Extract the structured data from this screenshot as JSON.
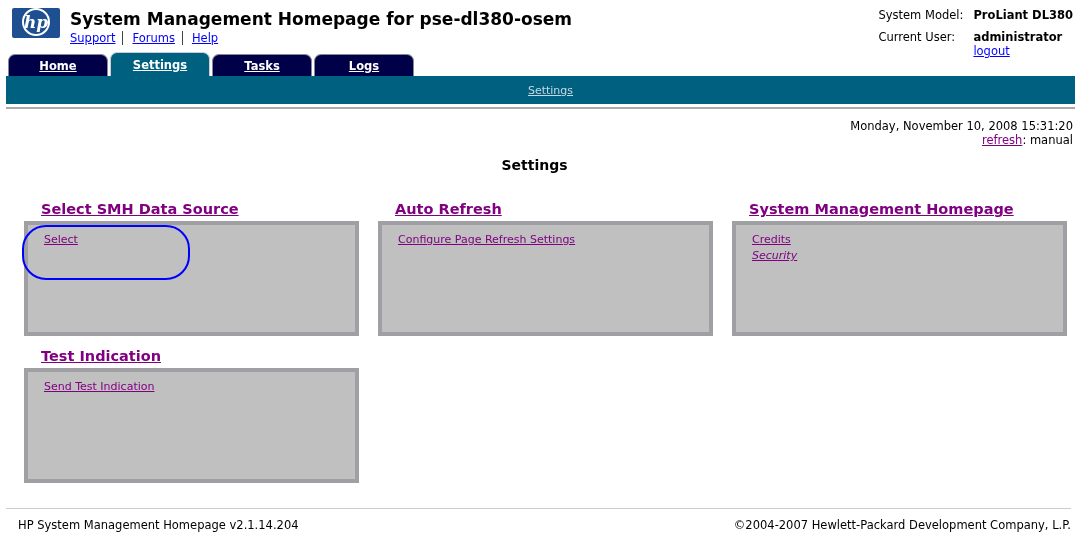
{
  "header": {
    "logo_text": "hp",
    "title": "System Management Homepage for pse-dl380-osem",
    "links": [
      "Support",
      "Forums",
      "Help"
    ],
    "info": [
      {
        "label": "System Model:",
        "value": "ProLiant DL380"
      },
      {
        "label": "Current User:",
        "value": "administrator"
      }
    ],
    "logout": "logout"
  },
  "tabs": [
    {
      "label": "Home",
      "selected": false
    },
    {
      "label": "Settings",
      "selected": true
    },
    {
      "label": "Tasks",
      "selected": false
    },
    {
      "label": "Logs",
      "selected": false
    }
  ],
  "subnav": [
    "Settings"
  ],
  "timestamp": "Monday, November 10, 2008 15:31:20",
  "refresh": {
    "link": "refresh",
    "value": ": manual"
  },
  "page_title": "Settings",
  "panels": [
    {
      "title": "Select SMH Data Source",
      "highlighted": true,
      "links": [
        {
          "text": "Select",
          "italic": false
        }
      ]
    },
    {
      "title": "Auto Refresh",
      "highlighted": false,
      "links": [
        {
          "text": "Configure Page Refresh Settings",
          "italic": false
        }
      ]
    },
    {
      "title": "System Management Homepage",
      "highlighted": false,
      "links": [
        {
          "text": "Credits",
          "italic": false
        },
        {
          "text": "Security",
          "italic": true
        }
      ]
    },
    {
      "title": "Test Indication",
      "highlighted": false,
      "links": [
        {
          "text": "Send Test Indication",
          "italic": false
        }
      ]
    }
  ],
  "footer": {
    "version": "HP System Management Homepage v2.1.14.204",
    "copyright": "©2004-2007 Hewlett-Packard Development Company, L.P."
  }
}
